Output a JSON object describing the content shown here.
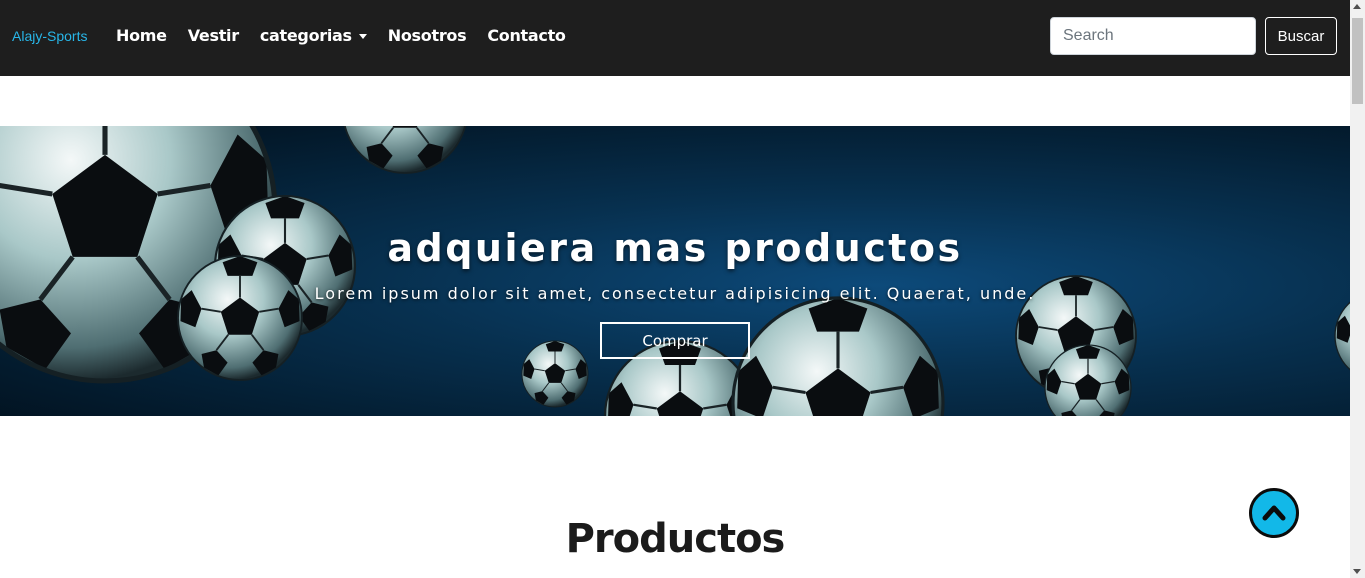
{
  "navbar": {
    "brand": "Alajy-Sports",
    "links": [
      {
        "label": "Home"
      },
      {
        "label": "Vestir"
      },
      {
        "label": "categorias",
        "dropdown": true
      },
      {
        "label": "Nosotros"
      },
      {
        "label": "Contacto"
      }
    ],
    "search_placeholder": "Search",
    "search_button": "Buscar"
  },
  "hero": {
    "title": "adquiera mas productos",
    "subtitle": "Lorem ipsum dolor sit amet, consectetur adipisicing elit. Quaerat, unde.",
    "button": "Comprar"
  },
  "section": {
    "title": "Productos"
  },
  "icons": {
    "back_to_top": "chevron-up-icon",
    "dropdown": "caret-down-icon"
  },
  "colors": {
    "navbar_bg": "#1e1e1e",
    "brand": "#28b6e8",
    "back_to_top_bg": "#12b8e8"
  }
}
